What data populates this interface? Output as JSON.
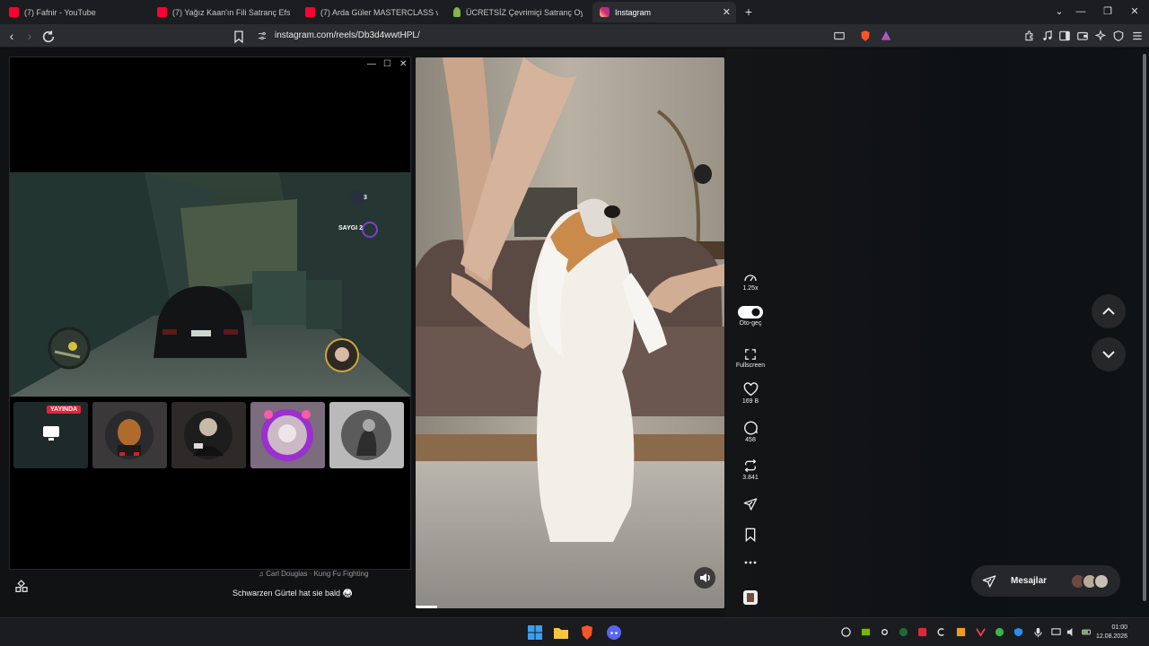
{
  "browser": {
    "tabs": [
      {
        "title": "(7) Fafnir - YouTube",
        "kind": "youtube"
      },
      {
        "title": "(7) Yağız Kaan'ın Fili Satranç Efsanesi",
        "kind": "youtube"
      },
      {
        "title": "(7) Arda Güler MASTERCLASS vs Fene",
        "kind": "youtube"
      },
      {
        "title": "ÜCRETSİZ Çevrimiçi Satranç Oynayın",
        "kind": "chess"
      },
      {
        "title": "Instagram",
        "kind": "instagram",
        "active": true
      }
    ],
    "new_tab_symbol": "+",
    "url": "instagram.com/reels/Db3d4wwtHPL/"
  },
  "pip": {
    "live_badge": "YAYINDA",
    "hud_respect": "SAYGI 2",
    "hud_count": "3"
  },
  "reel": {
    "music": "Carl Douglas · Kung Fu Fighting",
    "caption": "Schwarzen Gürtel hat sie bald 🥋",
    "progress": 0.07
  },
  "actions": {
    "speed": "1.25x",
    "autoplay_label": "Oto-geç",
    "fullscreen_label": "Fullscreen",
    "likes": "169 B",
    "comments": "458",
    "reposts": "3.841"
  },
  "messages": {
    "label": "Mesajlar"
  },
  "taskbar": {
    "time": "01:00",
    "date": "12.08.2026"
  },
  "colors": {
    "youtube": "#ff0033",
    "instagram": "#e1306c",
    "chess": "#81b64c",
    "live": "#e0263f",
    "brave": "#fb542b"
  }
}
